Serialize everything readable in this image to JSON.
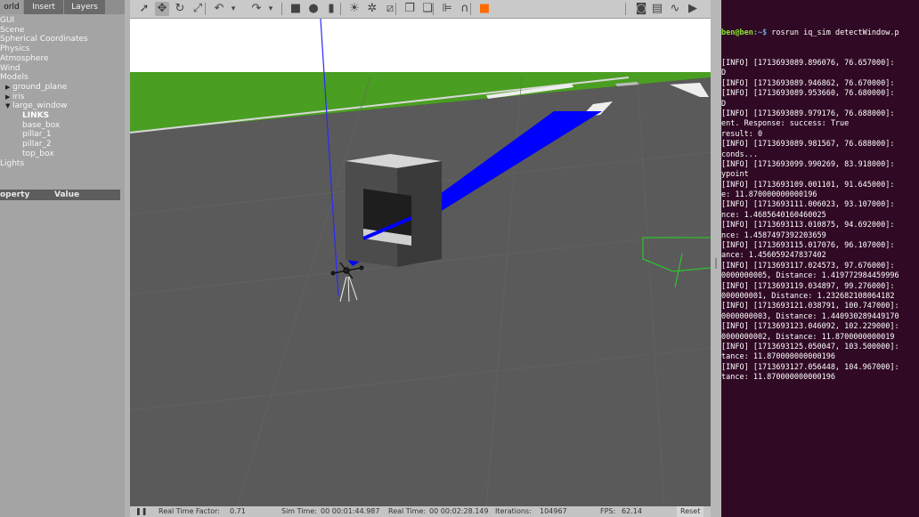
{
  "left_panel": {
    "tabs": [
      "orld",
      "Insert",
      "Layers"
    ],
    "tree": [
      {
        "label": "GUI",
        "indent": 0,
        "arrow": false
      },
      {
        "label": "Scene",
        "indent": 0,
        "arrow": false
      },
      {
        "label": "Spherical Coordinates",
        "indent": 0,
        "arrow": false
      },
      {
        "label": "Physics",
        "indent": 0,
        "arrow": false
      },
      {
        "label": "Atmosphere",
        "indent": 0,
        "arrow": false
      },
      {
        "label": "Wind",
        "indent": 0,
        "arrow": false
      },
      {
        "label": "Models",
        "indent": 0,
        "arrow": false
      },
      {
        "label": "ground_plane",
        "indent": 1,
        "arrow": "right"
      },
      {
        "label": "iris",
        "indent": 1,
        "arrow": "right"
      },
      {
        "label": "large_window",
        "indent": 1,
        "arrow": "down"
      },
      {
        "label": "LINKS",
        "indent": 2,
        "arrow": false
      },
      {
        "label": "base_box",
        "indent": 2,
        "arrow": false
      },
      {
        "label": "pillar_1",
        "indent": 2,
        "arrow": false
      },
      {
        "label": "pillar_2",
        "indent": 2,
        "arrow": false
      },
      {
        "label": "top_box",
        "indent": 2,
        "arrow": false
      },
      {
        "label": "Lights",
        "indent": 0,
        "arrow": false
      }
    ],
    "property_header": {
      "col1": "operty",
      "col2": "Value"
    }
  },
  "toolbar": {
    "icons": [
      "select-arrow-icon",
      "translate-icon",
      "rotate-icon",
      "scale-icon",
      "undo-icon",
      "dropdown-icon",
      "redo-icon",
      "dropdown-icon",
      "box-shape-icon",
      "sphere-shape-icon",
      "cylinder-shape-icon",
      "sun-light-icon",
      "point-light-icon",
      "spot-light-icon",
      "copy-icon",
      "paste-icon",
      "align-icon",
      "snap-icon",
      "orange-record-icon",
      "camera-icon",
      "log-icon",
      "plot-icon",
      "video-icon"
    ]
  },
  "statusbar": {
    "pause_glyph": "❚❚",
    "items": [
      "Real Time Factor:",
      "0.71",
      "Sim Time:",
      "00 00:01:44.987",
      "Real Time:",
      "00 00:02:28.149",
      "Iterations:",
      "104967",
      "FPS:",
      "62.14",
      "Reset"
    ]
  },
  "terminal": {
    "prompt_user": "ben@ben",
    "prompt_path": ":~$",
    "command": " rosrun iq_sim detectWindow.p",
    "lines": [
      "[INFO] [1713693089.896076, 76.657000]:",
      "D",
      "[INFO] [1713693089.946862, 76.670000]:",
      "[INFO] [1713693089.953660, 76.680000]:",
      "D",
      "[INFO] [1713693089.979176, 76.688000]:",
      "ent. Response: success: True",
      "result: 0",
      "[INFO] [1713693089.981567, 76.688000]:",
      "conds...",
      "[INFO] [1713693099.990269, 83.918000]:",
      "ypoint",
      "[INFO] [1713693109.001101, 91.645000]:",
      "e: 11.870000000000196",
      "[INFO] [1713693111.006023, 93.107000]:",
      "nce: 1.4685640160460025",
      "[INFO] [1713693113.010875, 94.692000]:",
      "nce: 1.4587497392203659",
      "[INFO] [1713693115.017076, 96.107000]:",
      "ance: 1.456059247837402",
      "[INFO] [1713693117.024573, 97.676000]:",
      "0000000005, Distance: 1.419772984459996",
      "[INFO] [1713693119.034897, 99.276000]:",
      "000000001, Distance: 1.232682108064182",
      "[INFO] [1713693121.038791, 100.747000]:",
      "0000000003, Distance: 1.440930289449170",
      "[INFO] [1713693123.046092, 102.229000]:",
      "0000000002, Distance: 11.8700000000019",
      "[INFO] [1713693125.050047, 103.500000]:",
      "tance: 11.870000000000196",
      "[INFO] [1713693127.056448, 104.967000]:",
      "tance: 11.870000000000196"
    ]
  },
  "colors": {
    "sky": "#ffffff",
    "grass": "#4a9e22",
    "asphalt": "#5a5a5a",
    "laser": "#0000ff",
    "terminal_bg": "#300a24",
    "selection_box": "#23d923"
  }
}
